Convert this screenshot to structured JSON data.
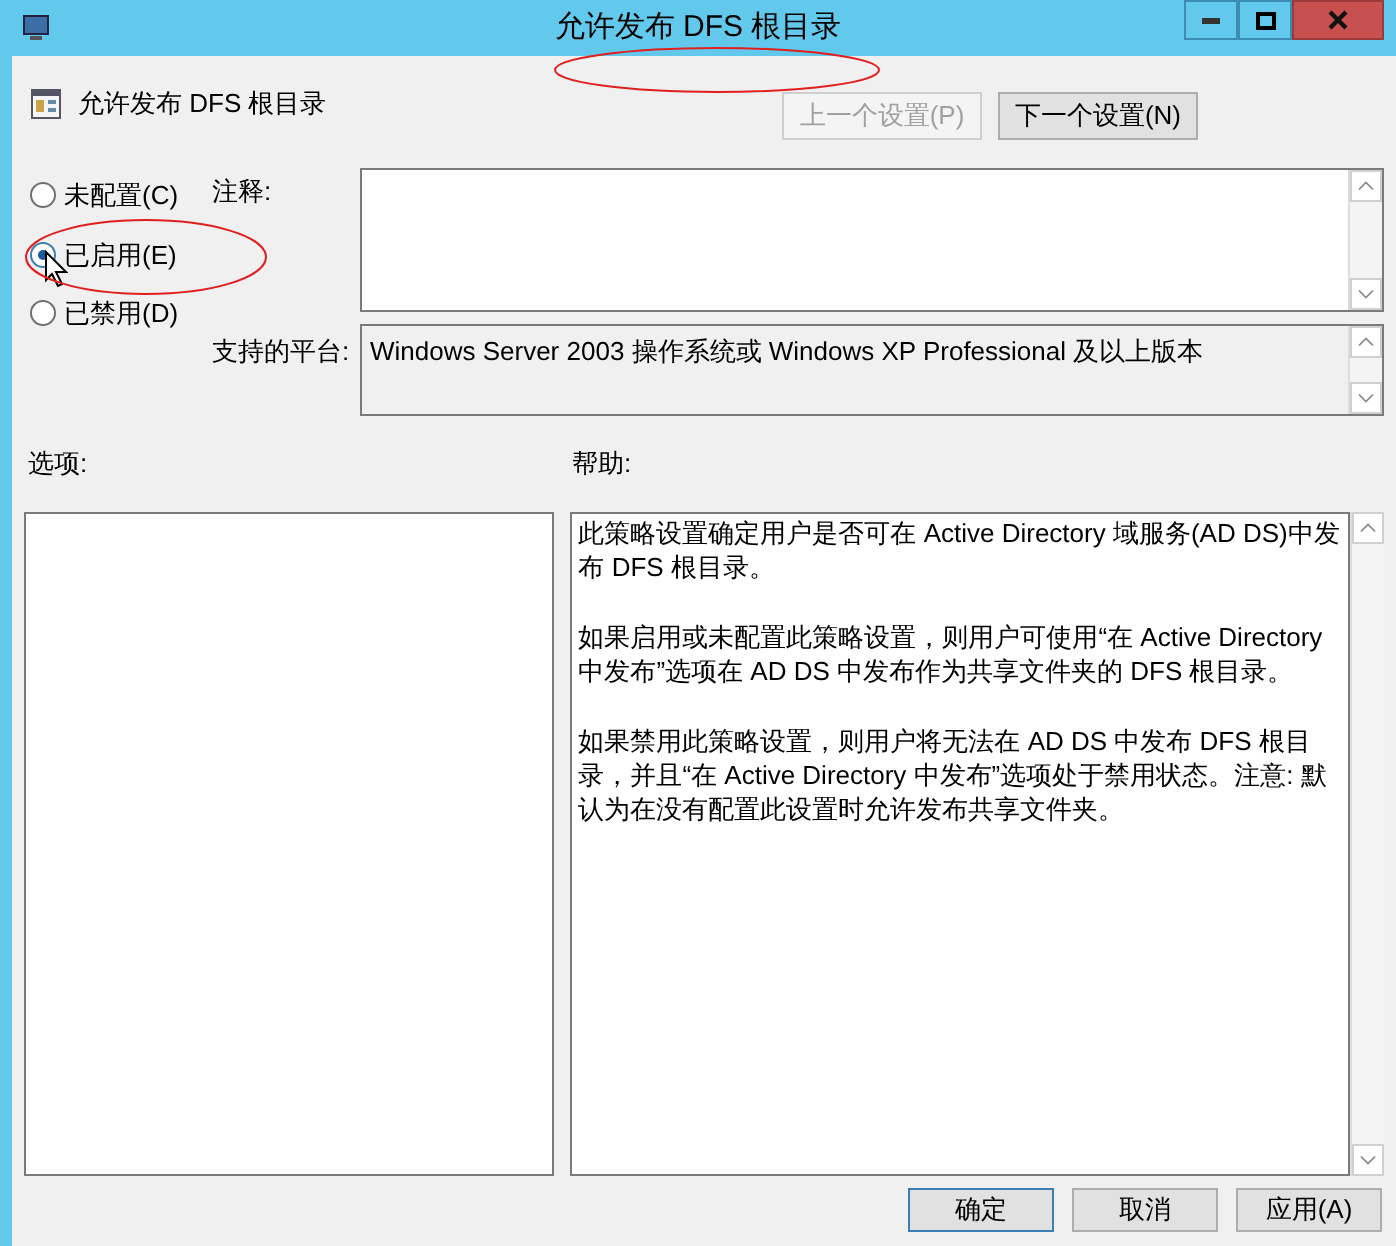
{
  "window": {
    "title": "允许发布 DFS 根目录"
  },
  "header": {
    "policy_name": "允许发布 DFS 根目录"
  },
  "nav_buttons": [
    {
      "label": "上一个设置(P)",
      "disabled": true
    },
    {
      "label": "下一个设置(N)",
      "disabled": false
    }
  ],
  "radios": [
    {
      "label": "未配置(C)",
      "selected": false
    },
    {
      "label": "已启用(E)",
      "selected": true
    },
    {
      "label": "已禁用(D)",
      "selected": false
    }
  ],
  "comment": {
    "label": "注释:"
  },
  "platform": {
    "label": "支持的平台:",
    "value": "Windows Server 2003 操作系统或 Windows XP Professional 及以上版本"
  },
  "options": {
    "label": "选项:"
  },
  "help": {
    "label": "帮助:",
    "paragraphs": [
      "此策略设置确定用户是否可在 Active Directory 域服务(AD DS)中发布 DFS 根目录。",
      "如果启用或未配置此策略设置，则用户可使用“在 Active Directory 中发布”选项在 AD DS 中发布作为共享文件夹的 DFS 根目录。",
      "如果禁用此策略设置，则用户将无法在 AD DS 中发布 DFS 根目录，并且“在 Active Directory 中发布”选项处于禁用状态。注意: 默认为在没有配置此设置时允许发布共享文件夹。"
    ]
  },
  "footer_buttons": [
    {
      "label": "确定"
    },
    {
      "label": "取消"
    },
    {
      "label": "应用(A)"
    }
  ]
}
